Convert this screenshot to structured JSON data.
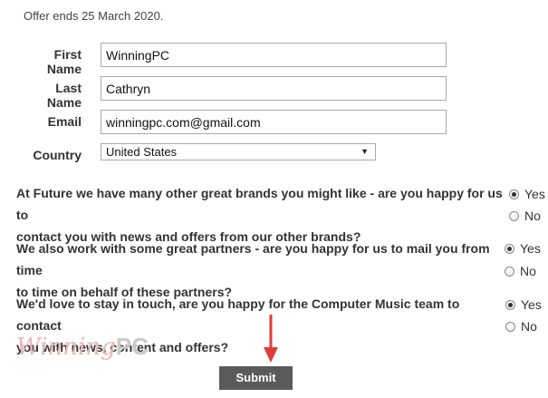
{
  "offer_text": "Offer ends 25 March 2020.",
  "form": {
    "first_name": {
      "label": "First Name",
      "value": "WinningPC"
    },
    "last_name": {
      "label": "Last Name",
      "value": "Cathryn"
    },
    "email": {
      "label": "Email",
      "value": "winningpc.com@gmail.com"
    },
    "country": {
      "label": "Country",
      "value": "United States"
    }
  },
  "questions": [
    {
      "line1": "At Future we have many other great brands you might like - are you happy for us to",
      "line2": "contact you with news and offers from our other brands?",
      "yes": "Yes",
      "no": "No",
      "selected": "Yes"
    },
    {
      "line1": "We also work with some great partners - are you happy for us to mail you from time",
      "line2": "to time on behalf of these partners?",
      "yes": "Yes",
      "no": "No",
      "selected": "Yes"
    },
    {
      "line1": "We'd love to stay in touch, are you happy for the Computer Music team to contact",
      "line2": "you with news, content and offers?",
      "yes": "Yes",
      "no": "No",
      "selected": "Yes"
    }
  ],
  "submit_label": "Submit",
  "watermark": {
    "script": "Winning",
    "suffix": "PC"
  },
  "colors": {
    "annotation_arrow": "#e03b3b",
    "submit_bg": "#5a5a5a"
  }
}
